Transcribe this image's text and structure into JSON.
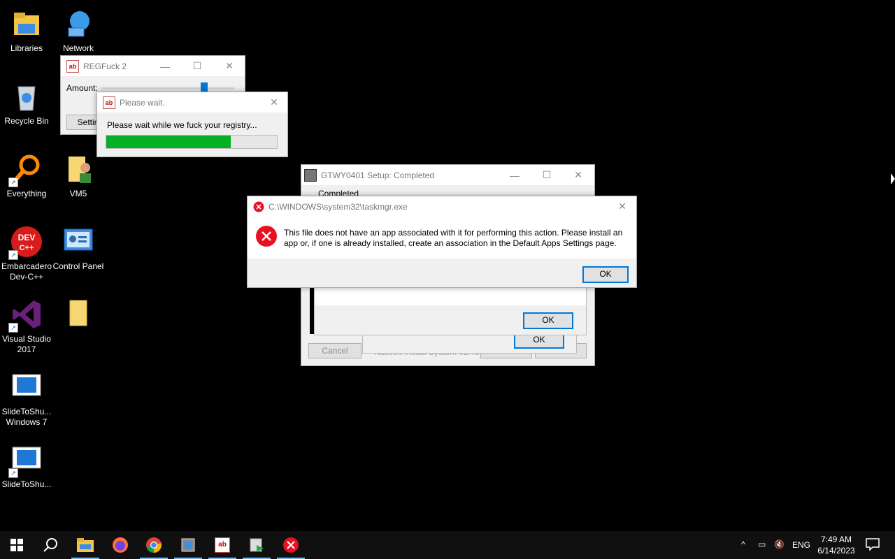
{
  "desktop": {
    "icons": [
      {
        "label": "Libraries"
      },
      {
        "label": "Network"
      },
      {
        "label": "Recycle Bin"
      },
      {
        "label": "Everything"
      },
      {
        "label": "VM5"
      },
      {
        "label": "Embarcadero Dev-C++"
      },
      {
        "label": "Control Panel"
      },
      {
        "label": ""
      },
      {
        "label": "Visual Studio 2017"
      },
      {
        "label": "SlideToShu... Windows 7"
      },
      {
        "label": "SlideToShu..."
      }
    ]
  },
  "regfuck": {
    "title": "REGFuck 2",
    "amount_label": "Amount:",
    "settings_label": "Settin"
  },
  "please_wait": {
    "title": "Please wait.",
    "message": "Please wait while we fuck your registry...",
    "progress": 0.73
  },
  "setup": {
    "title": "GTWY0401 Setup: Completed",
    "header_text": "Completed",
    "cancel_label": "Cancel",
    "footer_text": "Nullsoft Install System v2.46",
    "back_label": "< Back",
    "close_label": "Close",
    "inner_ok_label": "OK",
    "inner_ok2_label": "OK"
  },
  "error": {
    "title": "C:\\WINDOWS\\system32\\taskmgr.exe",
    "message": "This file does not have an app associated with it for performing this action. Please install an app or, if one is already installed, create an association in the Default Apps Settings page.",
    "ok_label": "OK"
  },
  "taskbar": {
    "items": [
      "start-icon",
      "search-icon",
      "file-explorer-icon",
      "firefox-icon",
      "chrome-icon",
      "setup-app-icon",
      "regfuck-app-icon",
      "installer-app-icon",
      "error-app-icon"
    ],
    "lang": "ENG",
    "time": "7:49 AM",
    "date": "6/14/2023"
  },
  "colors": {
    "progress_green": "#06b025",
    "accent": "#0078d7",
    "error_red": "#e81123"
  }
}
